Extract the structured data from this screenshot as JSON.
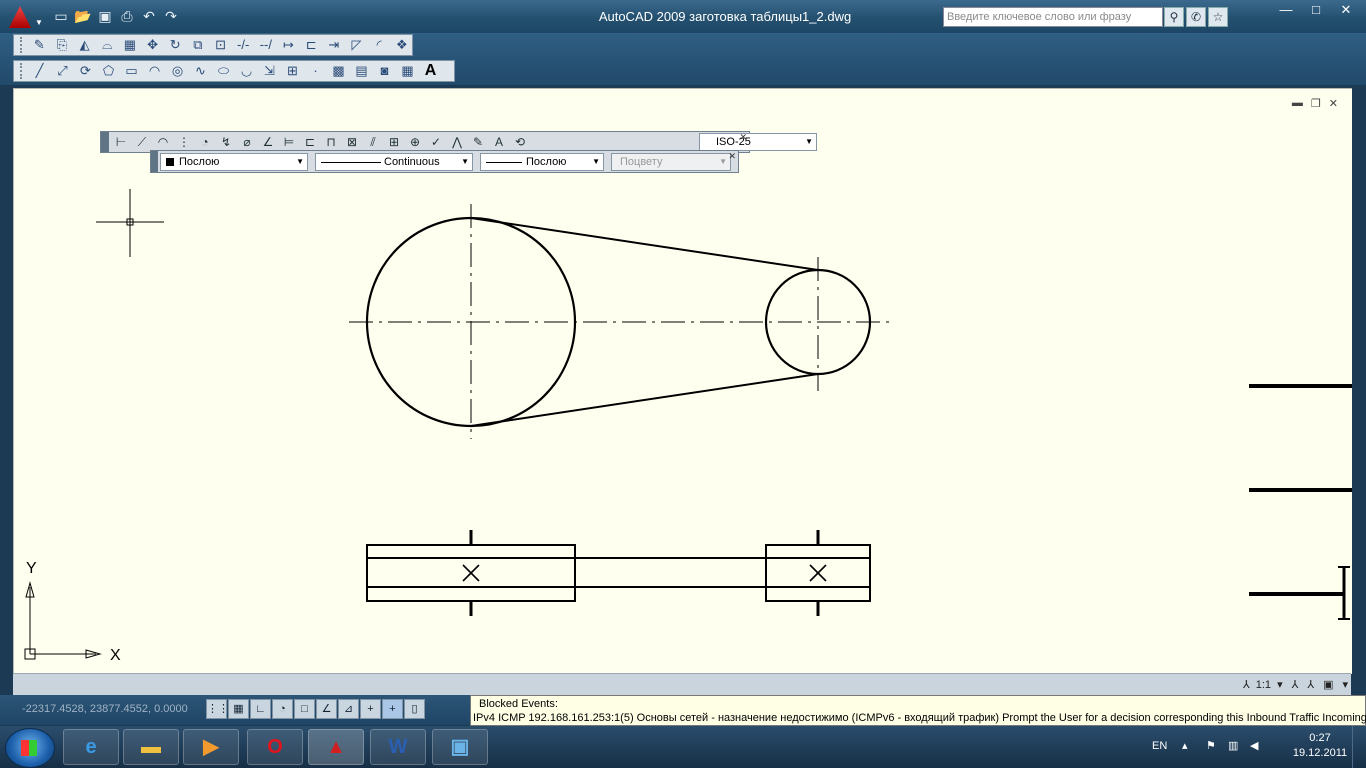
{
  "window": {
    "title": "AutoCAD 2009 заготовка таблицы1_2.dwg",
    "search_placeholder": "Введите ключевое слово или фразу",
    "controls": [
      "minimize",
      "maximize",
      "close"
    ]
  },
  "quick_access": [
    "new-icon",
    "open-icon",
    "save-icon",
    "print-icon",
    "undo-icon",
    "redo-icon"
  ],
  "toolbar_modify": {
    "icons": [
      "erase-icon",
      "copy-icon",
      "mirror-icon",
      "offset-icon",
      "array-icon",
      "move-icon",
      "rotate-icon",
      "scale-icon",
      "stretch-icon",
      "trim-icon",
      "extend-icon",
      "break-point-icon",
      "break-icon",
      "join-icon",
      "chamfer-icon",
      "fillet-icon",
      "explode-icon"
    ]
  },
  "toolbar_draw": {
    "icons": [
      "line-icon",
      "construction-line-icon",
      "polyline-icon",
      "polygon-icon",
      "rectangle-icon",
      "arc-icon",
      "circle-icon",
      "spline-icon",
      "ellipse-icon",
      "ellipse-arc-icon",
      "insert-block-icon",
      "make-block-icon",
      "point-icon",
      "hatch-icon",
      "gradient-icon",
      "region-icon",
      "table-icon",
      "mtext-icon"
    ],
    "mtext_label": "A"
  },
  "dim_toolbar": {
    "style": "ISO-25"
  },
  "properties_toolbar": {
    "color": "Послою",
    "linetype": "Continuous",
    "lineweight": "Послою",
    "plotstyle": "Поцвету"
  },
  "ucs": {
    "x_label": "X",
    "y_label": "Y"
  },
  "annotation": {
    "scale": "1:1"
  },
  "status": {
    "coords": "-22317.4528, 23877.4552, 0.0000",
    "toggles": [
      "snap",
      "grid",
      "ortho",
      "polar",
      "osnap",
      "otrack",
      "ducs",
      "dyn",
      "lwt",
      "qp"
    ]
  },
  "balloon": {
    "title": "Blocked Events:",
    "body": "IPv4 ICMP 192.168.161.253:1(5) Основы сетей - назначение недостижимо (ICMPv6 - входящий трафик) Prompt the User for a decision corresponding this Inbound Traffic Incoming"
  },
  "taskbar": {
    "apps": [
      "explorer",
      "ie",
      "media-player",
      "opera",
      "autocad",
      "word",
      "control-panel"
    ],
    "lang": "EN",
    "time": "0:27",
    "date": "19.12.2011"
  },
  "colors": {
    "canvas_bg": "#fffff0",
    "drawing_stroke": "#000000",
    "titlebar": "#24506f"
  }
}
